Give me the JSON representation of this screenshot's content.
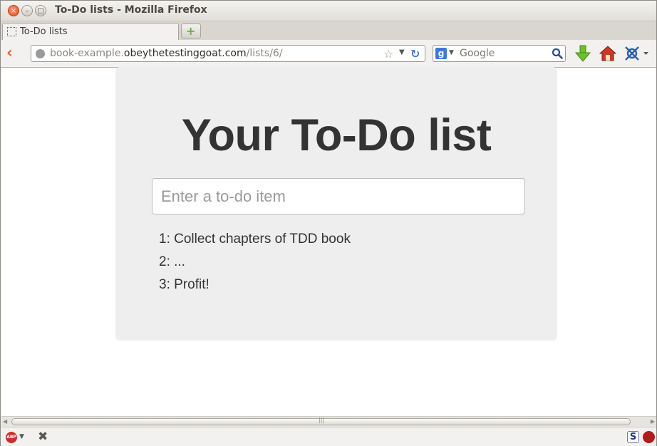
{
  "window": {
    "title": "To-Do lists - Mozilla Firefox",
    "close_glyph": "×",
    "min_glyph": "–",
    "max_glyph": "□"
  },
  "tabs": [
    {
      "label": "To-Do lists"
    }
  ],
  "newtab": {
    "glyph": "+"
  },
  "navbar": {
    "back_glyph": "‹",
    "url_prefix": "book-example.",
    "url_host": "obeythetestinggoat.com",
    "url_path": "/lists/6/",
    "star_glyph": "☆",
    "dropdown_glyph": "▼",
    "reload_glyph": "↻",
    "search_engine_letter": "g",
    "search_placeholder": "Google"
  },
  "page": {
    "heading": "Your To-Do list",
    "input_placeholder": "Enter a to-do item",
    "items": [
      "1: Collect chapters of TDD book",
      "2: ...",
      "3: Profit!"
    ]
  },
  "scrollbar": {
    "left_glyph": "◀",
    "right_glyph": "▶",
    "grip_glyph": "|||"
  },
  "statusbar": {
    "abp_label": "ABP",
    "abp_dd_glyph": "▼",
    "close_glyph": "✖",
    "s_label": "S"
  },
  "colors": {
    "panel_bg": "#eeeeee",
    "heading": "#333333",
    "close_button": "#e2541d",
    "accent_blue": "#3b7bd6",
    "download_green": "#6fbf2a",
    "home_red": "#c83a26"
  }
}
